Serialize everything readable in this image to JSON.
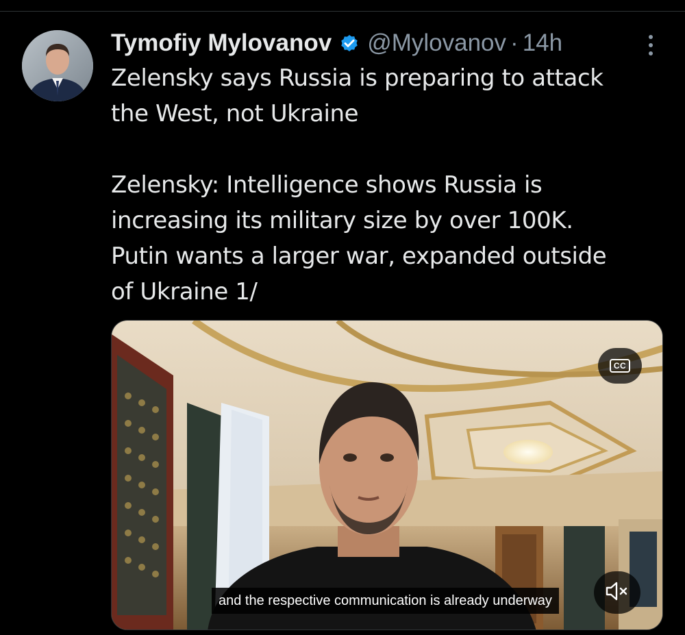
{
  "tweet": {
    "author": {
      "display_name": "Tymofiy Mylovanov",
      "handle": "@Mylovanov",
      "verified": true
    },
    "separator": "·",
    "timestamp": "14h",
    "text_lines": [
      "Zelensky says Russia is preparing to attack",
      "the West, not Ukraine",
      "Zelensky: Intelligence shows Russia is",
      "increasing its military size by over 100K.",
      "Putin wants a larger war, expanded outside",
      "of Ukraine 1/"
    ],
    "media": {
      "type": "video",
      "cc_label": "CC",
      "caption": "and the respective communication is already underway",
      "muted": true
    }
  },
  "icons": {
    "verified": "verified-badge-icon",
    "more": "more-options-icon",
    "mute": "muted-speaker-icon"
  },
  "colors": {
    "background": "#000000",
    "text": "#e7e9ea",
    "secondary_text": "#8b98a5",
    "verified_blue": "#1d9bf0"
  }
}
